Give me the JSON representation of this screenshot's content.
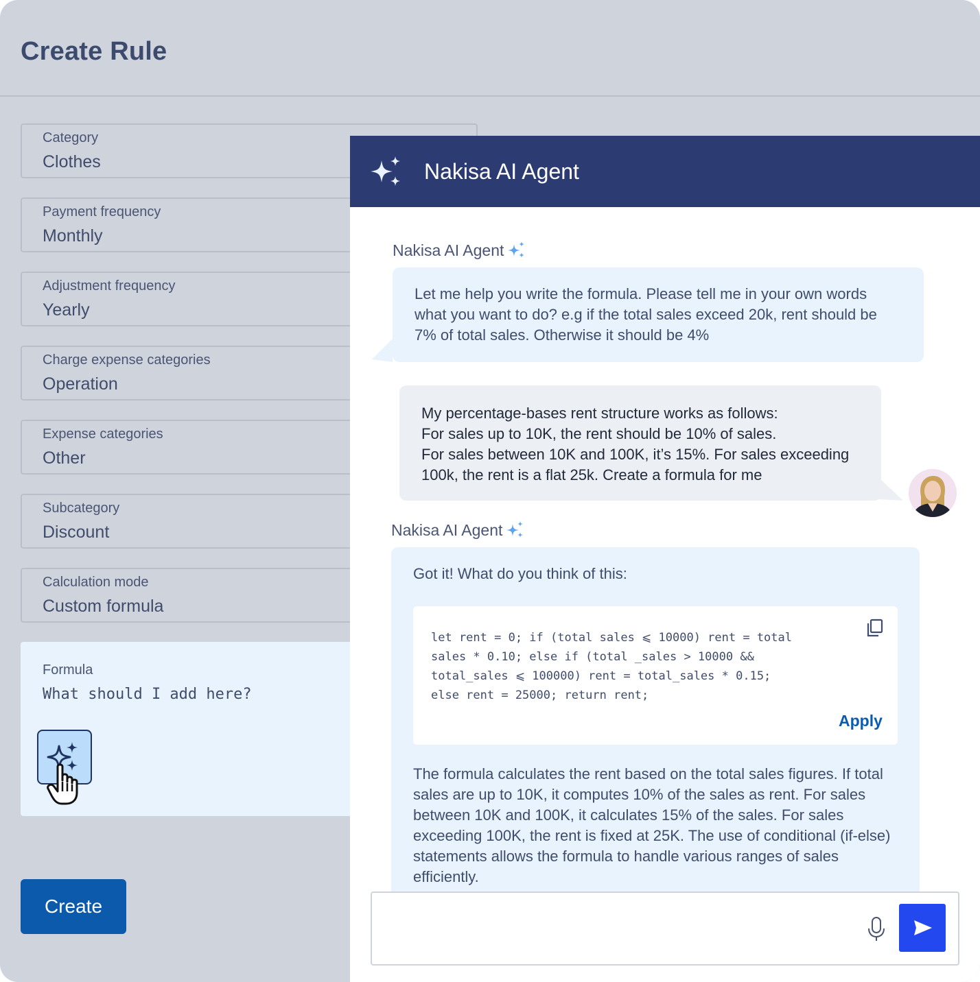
{
  "page": {
    "title": "Create Rule"
  },
  "fields": [
    {
      "label": "Category",
      "value": "Clothes"
    },
    {
      "label": "Payment frequency",
      "value": "Monthly"
    },
    {
      "label": "Adjustment frequency",
      "value": "Yearly"
    },
    {
      "label": "Charge expense categories",
      "value": "Operation"
    },
    {
      "label": "Expense categories",
      "value": "Other"
    },
    {
      "label": "Subcategory",
      "value": "Discount"
    },
    {
      "label": "Calculation mode",
      "value": "Custom formula"
    }
  ],
  "formula": {
    "label": "Formula",
    "value": "What should I add here?",
    "ai_icon": "sparkles-icon"
  },
  "create_button": {
    "label": "Create"
  },
  "chat": {
    "title": "Nakisa AI Agent",
    "messages": [
      {
        "sender": "Nakisa AI Agent",
        "text": "Let me help you write the formula. Please tell me in your own words\n what you want to do? e.g if the total sales exceed 20k, rent should be\n 7% of total sales. Otherwise it should be 4%"
      },
      {
        "sender": "user",
        "text": "My percentage-bases rent structure works as follows:\nFor sales up to 10K, the rent should be 10% of sales.\nFor sales between 10K and 100K, it’s 15%. For sales exceeding\n100k, the rent is a flat 25k. Create a formula for me"
      },
      {
        "sender": "Nakisa AI Agent",
        "intro": "Got it! What do you think of this:",
        "code": "let rent = 0; if (total sales ⩽ 10000) rent = total\nsales * 0.10; else if (total _sales > 10000 &&\ntotal_sales ⩽ 100000) rent = total_sales * 0.15;\nelse rent = 25000; return rent;",
        "apply_label": "Apply",
        "explanation": "The formula calculates the rent based on the total sales figures. If total sales are up to 10K, it computes 10% of the sales as rent. For sales between 10K and 100K, it calculates 15% of the sales. For sales exceeding 100K, the rent is fixed at 25K. The use of conditional (if-else) statements allows the formula to handle various ranges of sales efficiently."
      }
    ],
    "input": {
      "value": "",
      "placeholder": ""
    }
  },
  "colors": {
    "header": "#2d3b73",
    "accent": "#0b5aac",
    "send": "#2448ef",
    "agent_bubble": "#e9f3fd",
    "sparkle": "#5aa4f0"
  }
}
